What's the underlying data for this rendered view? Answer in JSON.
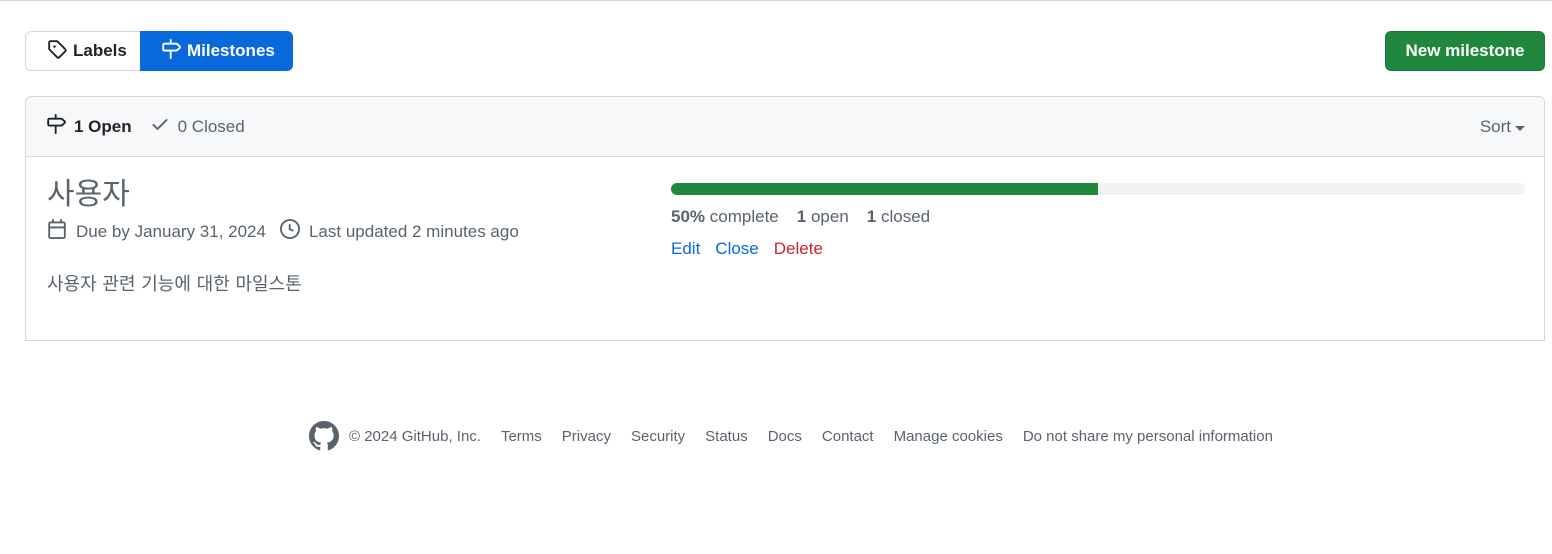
{
  "subnav": {
    "labels": "Labels",
    "milestones": "Milestones"
  },
  "new_milestone_button": "New milestone",
  "box": {
    "open": "1 Open",
    "closed": "0 Closed",
    "sort": "Sort"
  },
  "milestone": {
    "title": "사용자",
    "due": "Due by January 31, 2024",
    "updated": "Last updated 2 minutes ago",
    "description": "사용자 관련 기능에 대한 마일스톤",
    "progress_percent": 50,
    "complete_pct": "50%",
    "complete_label": "complete",
    "open_count": "1",
    "open_label": "open",
    "closed_count": "1",
    "closed_label": "closed",
    "actions": {
      "edit": "Edit",
      "close": "Close",
      "delete": "Delete"
    }
  },
  "footer": {
    "copyright": "© 2024 GitHub, Inc.",
    "links": [
      "Terms",
      "Privacy",
      "Security",
      "Status",
      "Docs",
      "Contact",
      "Manage cookies",
      "Do not share my personal information"
    ]
  },
  "colors": {
    "accent": "#0969da",
    "success": "#1f883d",
    "danger": "#d1242f",
    "muted": "#59636e"
  }
}
